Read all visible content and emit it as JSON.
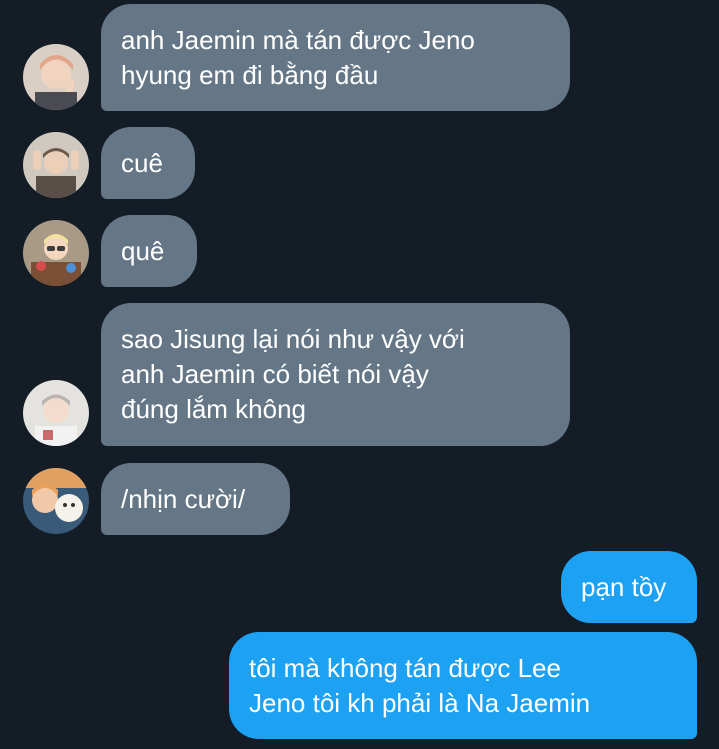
{
  "conversation": {
    "messages": [
      {
        "direction": "incoming",
        "lines": [
          "anh Jaemin mà tán được Jeno",
          "hyung em đi bằng đầu"
        ]
      },
      {
        "direction": "incoming",
        "lines": [
          "cuê"
        ]
      },
      {
        "direction": "incoming",
        "lines": [
          "quê"
        ]
      },
      {
        "direction": "incoming",
        "lines": [
          "sao Jisung lại nói như vậy với",
          "anh Jaemin có biết nói vậy",
          "đúng lắm không"
        ]
      },
      {
        "direction": "incoming",
        "lines": [
          "/nhịn cười/"
        ]
      },
      {
        "direction": "outgoing",
        "lines": [
          "pạn tồy"
        ]
      },
      {
        "direction": "outgoing",
        "lines": [
          "tôi mà không tán được Lee",
          "Jeno tôi kh phải là Na Jaemin"
        ]
      }
    ]
  },
  "colors": {
    "background": "#141d26",
    "incoming_bubble": "#657786",
    "outgoing_bubble": "#1da1f2",
    "text": "#ffffff"
  }
}
